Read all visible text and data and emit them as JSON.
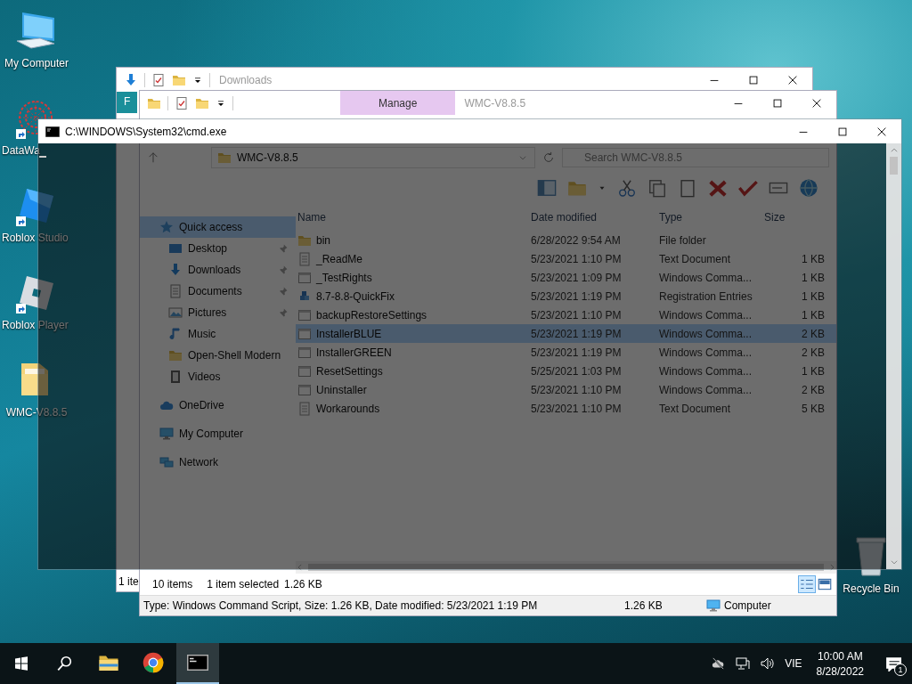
{
  "desktop_icons": [
    {
      "label": "My Computer",
      "kind": "computer",
      "shortcut": false
    },
    {
      "label": "DataWa",
      "kind": "mesh",
      "shortcut": true
    },
    {
      "label": "Roblox Studio",
      "kind": "studio",
      "shortcut": true
    },
    {
      "label": "Roblox Player",
      "kind": "player",
      "shortcut": true
    },
    {
      "label": "WMC-V8.8.5",
      "kind": "folder",
      "shortcut": false
    }
  ],
  "recycle_bin": {
    "label": "Recycle Bin"
  },
  "downloads_window": {
    "title": "Downloads",
    "ribbon_tab": "F",
    "status": "1 ite"
  },
  "explorer_window": {
    "title": "WMC-V8.8.5",
    "context_tab": "Manage",
    "address": "WMC-V8.8.5",
    "search": {
      "placeholder": "Search WMC-V8.8.5"
    },
    "nav": [
      {
        "label": "Quick access",
        "kind": "star",
        "selected": true,
        "pinned": false,
        "children": [
          {
            "label": "Desktop",
            "kind": "desktop",
            "selected": false,
            "pinned": true
          },
          {
            "label": "Downloads",
            "kind": "download",
            "selected": false,
            "pinned": true
          },
          {
            "label": "Documents",
            "kind": "document",
            "selected": false,
            "pinned": true
          },
          {
            "label": "Pictures",
            "kind": "picture",
            "selected": false,
            "pinned": true
          },
          {
            "label": "Music",
            "kind": "music",
            "selected": false,
            "pinned": false
          },
          {
            "label": "Open-Shell Modern",
            "kind": "folder",
            "selected": false,
            "pinned": false
          },
          {
            "label": "Videos",
            "kind": "video",
            "selected": false,
            "pinned": false
          }
        ]
      },
      {
        "label": "OneDrive",
        "kind": "cloud",
        "selected": false,
        "pinned": false
      },
      {
        "label": "My Computer",
        "kind": "computer",
        "selected": false,
        "pinned": false
      },
      {
        "label": "Network",
        "kind": "network",
        "selected": false,
        "pinned": false
      }
    ],
    "columns": [
      "Name",
      "Date modified",
      "Type",
      "Size"
    ],
    "files": [
      {
        "name": "bin",
        "date": "6/28/2022 9:54 AM",
        "type": "File folder",
        "kind": "folder",
        "selected": false
      },
      {
        "name": "_ReadMe",
        "date": "5/23/2021 1:10 PM",
        "type": "Text Document",
        "size": "1 KB",
        "kind": "text",
        "selected": false
      },
      {
        "name": "_TestRights",
        "date": "5/23/2021 1:09 PM",
        "type": "Windows Comma...",
        "size": "1 KB",
        "kind": "script",
        "selected": false
      },
      {
        "name": "8.7-8.8-QuickFix",
        "date": "5/23/2021 1:19 PM",
        "type": "Registration Entries",
        "size": "1 KB",
        "kind": "registry",
        "selected": false
      },
      {
        "name": "backupRestoreSettings",
        "date": "5/23/2021 1:10 PM",
        "type": "Windows Comma...",
        "size": "1 KB",
        "kind": "script",
        "selected": false
      },
      {
        "name": "InstallerBLUE",
        "date": "5/23/2021 1:19 PM",
        "type": "Windows Comma...",
        "size": "2 KB",
        "kind": "script",
        "selected": true
      },
      {
        "name": "InstallerGREEN",
        "date": "5/23/2021 1:19 PM",
        "type": "Windows Comma...",
        "size": "2 KB",
        "kind": "script",
        "selected": false
      },
      {
        "name": "ResetSettings",
        "date": "5/25/2021 1:03 PM",
        "type": "Windows Comma...",
        "size": "1 KB",
        "kind": "script",
        "selected": false
      },
      {
        "name": "Uninstaller",
        "date": "5/23/2021 1:10 PM",
        "type": "Windows Comma...",
        "size": "2 KB",
        "kind": "script",
        "selected": false
      },
      {
        "name": "Workarounds",
        "date": "5/23/2021 1:10 PM",
        "type": "Text Document",
        "size": "5 KB",
        "kind": "text",
        "selected": false
      }
    ],
    "status": {
      "count": "10 items",
      "selection": "1 item selected",
      "size": "1.26 KB"
    },
    "views": [
      {
        "kind": "details",
        "selected": true
      },
      {
        "kind": "tiles",
        "selected": false
      }
    ],
    "details": {
      "text": "Type: Windows Command Script, Size: 1.26 KB, Date modified: 5/23/2021 1:19 PM",
      "size": "1.26 KB",
      "location": "Computer"
    }
  },
  "cmd_window": {
    "title": "C:\\WINDOWS\\System32\\cmd.exe"
  },
  "taskbar": {
    "apps": [
      {
        "kind": "explorer",
        "selected": false
      },
      {
        "kind": "chrome",
        "selected": false
      },
      {
        "kind": "terminal",
        "selected": true
      }
    ],
    "language": "VIE",
    "time": "10:00 AM",
    "date": "8/28/2022",
    "notification_count": "1"
  }
}
